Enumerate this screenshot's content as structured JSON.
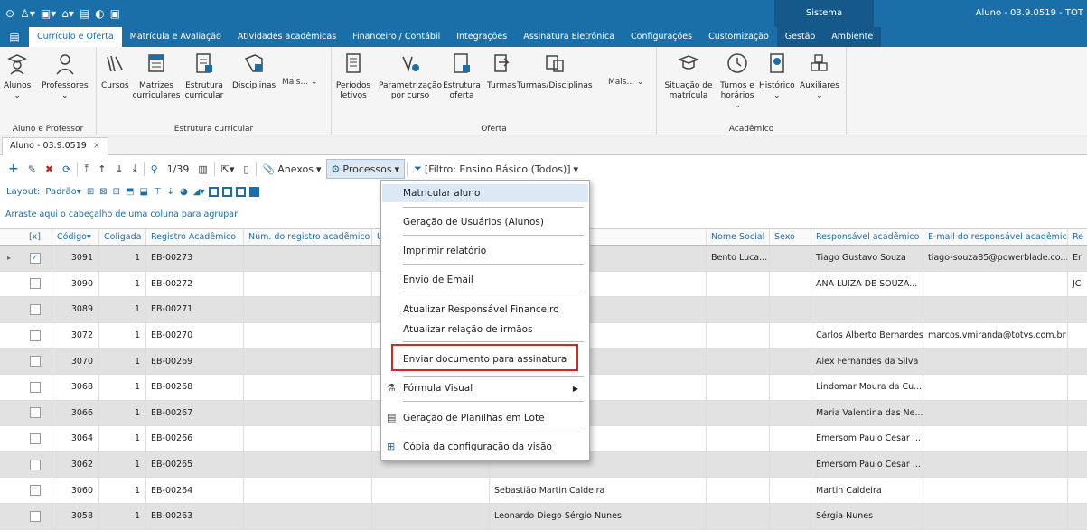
{
  "titlebar": {
    "system": "Sistema",
    "window_title": "Aluno - 03.9.0519 - TOT"
  },
  "menubar": {
    "items": [
      "Currículo e Oferta",
      "Matrícula e Avaliação",
      "Atividades acadêmicas",
      "Financeiro / Contábil",
      "Integrações",
      "Assinatura Eletrônica",
      "Configurações",
      "Customização",
      "Gestão",
      "Ambiente"
    ]
  },
  "ribbon": {
    "groups": [
      {
        "label": "Aluno e Professor",
        "buttons": [
          "Alunos",
          "Professores"
        ]
      },
      {
        "label": "Estrutura curricular",
        "buttons": [
          "Cursos",
          "Matrizes curriculares",
          "Estrutura curricular",
          "Disciplinas"
        ],
        "more": "Mais..."
      },
      {
        "label": "Oferta",
        "buttons": [
          "Períodos letivos",
          "Parametrização por curso",
          "Estrutura oferta",
          "Turmas",
          "Turmas/Disciplinas"
        ],
        "more": "Mais..."
      },
      {
        "label": "Acadêmico",
        "buttons": [
          "Situação de matrícula",
          "Turnos e horários",
          "Histórico",
          "Auxiliares"
        ]
      }
    ]
  },
  "doctab": {
    "label": "Aluno - 03.9.0519"
  },
  "toolbar": {
    "page": "1/39",
    "anexos": "Anexos",
    "processos": "Processos",
    "filtro": "[Filtro: Ensino Básico (Todos)]"
  },
  "toolbar2": {
    "layout": "Layout:",
    "padrao": "Padrão"
  },
  "grouphint": "Arraste aqui o cabeçalho de uma coluna para agrupar",
  "grid": {
    "headers": {
      "sel": "[x]",
      "codigo": "Código",
      "coligada": "Coligada",
      "registro": "Registro Acadêmico",
      "num_registro": "Núm. do registro acadêmico",
      "u": "U",
      "nome_social": "Nome Social",
      "sexo": "Sexo",
      "responsavel": "Responsável acadêmico",
      "email": "E-mail do responsável acadêmico",
      "re": "Re"
    },
    "rows": [
      {
        "checked": true,
        "codigo": "3091",
        "coligada": "1",
        "registro": "EB-00273",
        "nome_tail": "ão",
        "nome_social": "Bento Luca...",
        "responsavel": "Tiago Gustavo Souza",
        "email": "tiago-souza85@powerblade.co...",
        "extra": "Er"
      },
      {
        "checked": false,
        "codigo": "3090",
        "coligada": "1",
        "registro": "EB-00272",
        "nome_tail": "tro",
        "nome_social": "",
        "responsavel": "ANA LUIZA  DE SOUZA...",
        "email": "",
        "extra": "JC"
      },
      {
        "checked": false,
        "codigo": "3089",
        "coligada": "1",
        "registro": "EB-00271",
        "nome_tail": "a",
        "nome_social": "",
        "responsavel": "",
        "email": "",
        "extra": ""
      },
      {
        "checked": false,
        "codigo": "3072",
        "coligada": "1",
        "registro": "EB-00270",
        "nome_tail": "des",
        "nome_social": "",
        "responsavel": "Carlos Alberto Bernardes",
        "email": "marcos.vmiranda@totvs.com.br",
        "extra": ""
      },
      {
        "checked": false,
        "codigo": "3070",
        "coligada": "1",
        "registro": "EB-00269",
        "nome_tail": "ilva",
        "nome_social": "",
        "responsavel": "Alex Fernandes da Silva",
        "email": "",
        "extra": ""
      },
      {
        "checked": false,
        "codigo": "3068",
        "coligada": "1",
        "registro": "EB-00268",
        "nome_tail": "Cunha",
        "nome_social": "",
        "responsavel": "Lindomar Moura da Cu...",
        "email": "",
        "extra": ""
      },
      {
        "checked": false,
        "codigo": "3066",
        "coligada": "1",
        "registro": "EB-00267",
        "nome_tail": "Neves",
        "nome_social": "",
        "responsavel": "Maria Valentina das Ne...",
        "email": "",
        "extra": ""
      },
      {
        "checked": false,
        "codigo": "3064",
        "coligada": "1",
        "registro": "EB-00266",
        "nome_tail": "ti",
        "nome_social": "",
        "responsavel": "Emersom Paulo Cesar ...",
        "email": "",
        "extra": ""
      },
      {
        "checked": false,
        "codigo": "3062",
        "coligada": "1",
        "registro": "EB-00265",
        "nome_tail": "",
        "nome_social": "",
        "responsavel": "Emersom Paulo Cesar ...",
        "email": "",
        "extra": ""
      },
      {
        "checked": false,
        "codigo": "3060",
        "coligada": "1",
        "registro": "EB-00264",
        "nome_tail": "Sebastião Martin Caldeira",
        "nome_social": "",
        "responsavel": "Martin Caldeira",
        "email": "",
        "extra": ""
      },
      {
        "checked": false,
        "codigo": "3058",
        "coligada": "1",
        "registro": "EB-00263",
        "nome_tail": "Leonardo Diego Sérgio Nunes",
        "nome_social": "",
        "responsavel": "Sérgia Nunes",
        "email": "",
        "extra": ""
      }
    ]
  },
  "menu": {
    "items": [
      "Matricular aluno",
      "Geração de Usuários (Alunos)",
      "Imprimir relatório",
      "Envio de Email",
      "Atualizar Responsável Financeiro",
      "Atualizar relação de irmãos",
      "Enviar documento para assinatura",
      "Fórmula Visual",
      "Geração de Planilhas em Lote",
      "Cópia da configuração da visão"
    ]
  }
}
